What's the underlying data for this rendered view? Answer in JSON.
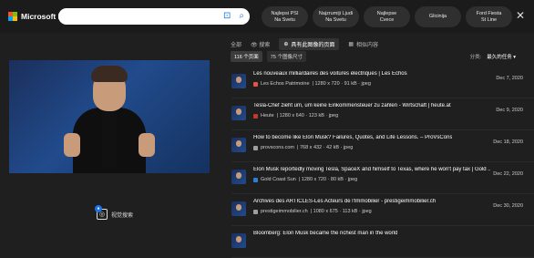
{
  "brand": {
    "name": "Microsoft Bing",
    "logo_colors": [
      "#f35325",
      "#81bc06",
      "#05a6f0",
      "#ffba08"
    ]
  },
  "search": {
    "value": ""
  },
  "chips": [
    {
      "line1": "Najlepsi PSI",
      "line2": "Na Svetu"
    },
    {
      "line1": "Najzrumiji Ljudi",
      "line2": "Na Svetu"
    },
    {
      "line1": "Najlepse",
      "line2": "Cvece"
    },
    {
      "line1": "Glicinija",
      "line2": ""
    },
    {
      "line1": "Ford Fiesta",
      "line2": "St Line"
    }
  ],
  "preview": {
    "footer_label": "视觉搜索"
  },
  "tabs": [
    {
      "label": "全部"
    },
    {
      "label": "👁 搜索"
    },
    {
      "label": "具有此图像的页面"
    },
    {
      "label": "相似内容"
    }
  ],
  "subtabs": [
    {
      "label": "116 个页面"
    },
    {
      "label": "75 个图像尺寸"
    }
  ],
  "sort": {
    "label": "分类:",
    "value": "最久的任务 ▾"
  },
  "results": [
    {
      "title": "Les nouveaux milliardaires des voitures électriques | Les Echos",
      "source": "Les Echos Patrimoine",
      "info": "| 1280 x 720 · 91 kB · jpeg",
      "date": "Dec 7, 2020"
    },
    {
      "title": "Tesla-Chef zieht um, um keine Einkommensteuer zu zahlen - Wirtschaft | heute.at",
      "source": "Heute",
      "info": "| 1280 x 640 · 123 kB · jpeg",
      "date": "Dec 9, 2020"
    },
    {
      "title": "How to become like Elon Musk? Failures, Quotes, and Life Lessons. – ProVsCons",
      "source": "provscons.com",
      "info": "| 768 x 432 · 42 kB · jpeg",
      "date": "Dec 18, 2020"
    },
    {
      "title": "Elon Musk reportedly moving Tesla, SpaceX and himself to Texas, where he won't pay tax | Gold ...",
      "source": "Gold Coast Sun",
      "info": "| 1280 x 720 · 80 kB · jpeg",
      "date": "Dec 22, 2020"
    },
    {
      "title": "Archives des ARTICLES-Les Acteurs de l'Immobilier - prestigeimmobilier.ch",
      "source": "prestigeimmobilier.ch",
      "info": "| 1080 x 675 · 113 kB · jpeg",
      "date": "Dec 30, 2020"
    },
    {
      "title": "Bloomberg: Elon Musk became the richest man in the world",
      "source": "",
      "info": "",
      "date": ""
    }
  ]
}
